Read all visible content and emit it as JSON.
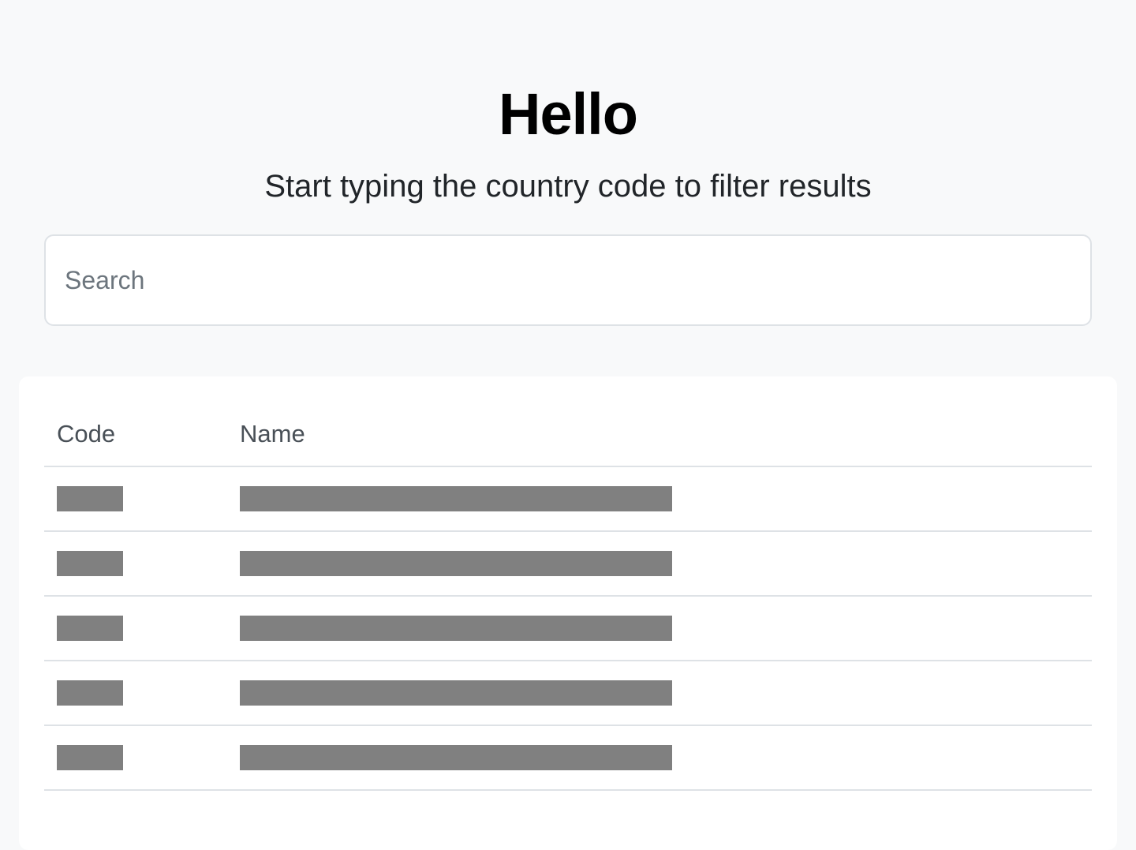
{
  "header": {
    "title": "Hello",
    "subtitle": "Start typing the country code to filter results"
  },
  "search": {
    "placeholder": "Search",
    "value": ""
  },
  "table": {
    "columns": [
      "Code",
      "Name"
    ],
    "rows": [
      {
        "state": "loading-placeholder"
      },
      {
        "state": "loading-placeholder"
      },
      {
        "state": "loading-placeholder"
      },
      {
        "state": "loading-placeholder"
      },
      {
        "state": "loading-placeholder"
      }
    ]
  },
  "colors": {
    "background": "#f8f9fa",
    "card": "#ffffff",
    "placeholder_bar": "#808080",
    "border": "#dee2e6"
  }
}
